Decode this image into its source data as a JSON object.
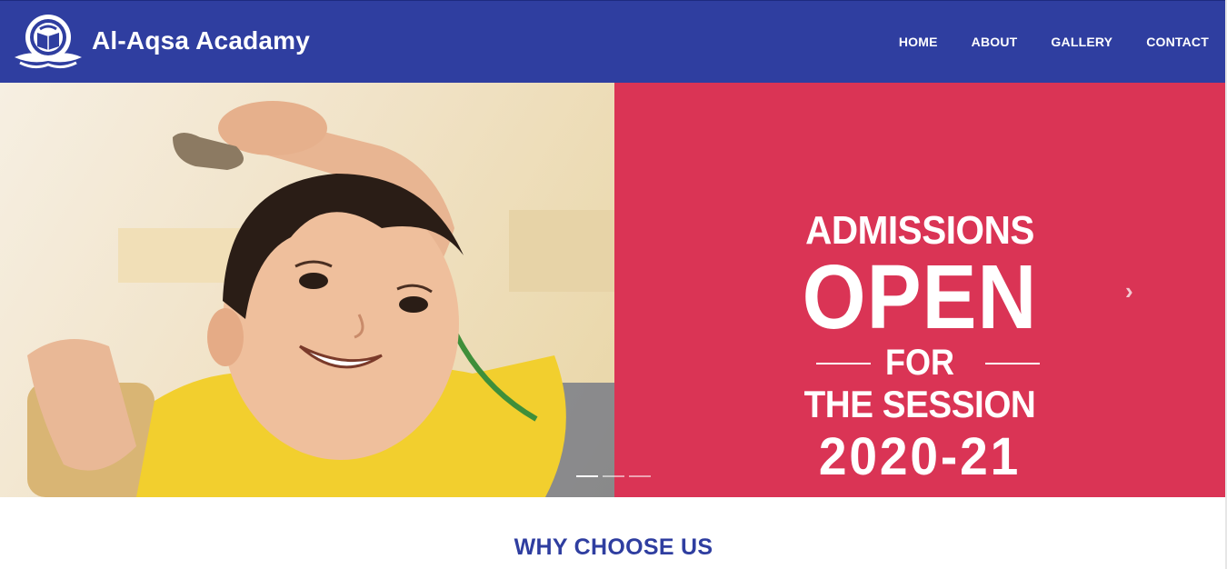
{
  "header": {
    "brand_name": "Al-Aqsa Acadamy",
    "nav": [
      "HOME",
      "ABOUT",
      "GALLERY",
      "CONTACT"
    ]
  },
  "hero": {
    "slide_text": {
      "line1": "ADMISSIONS",
      "line2": "OPEN",
      "line3": "FOR",
      "line4": "THE SESSION",
      "line5": "2020-21"
    },
    "next_icon": "chevron-right-icon",
    "slide_count": 3,
    "active_slide": 1,
    "colors": {
      "panel": "#da3455",
      "navbar": "#2f3ea0"
    }
  },
  "section": {
    "heading": "WHY CHOOSE US"
  }
}
